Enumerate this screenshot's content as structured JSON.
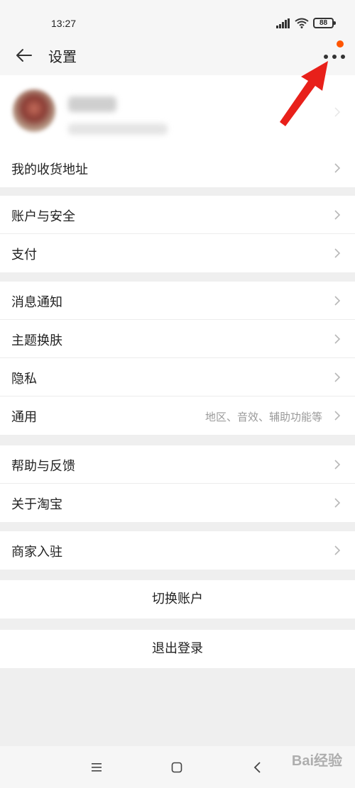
{
  "status_bar": {
    "time": "13:27",
    "battery": "88"
  },
  "header": {
    "title": "设置"
  },
  "groups": [
    {
      "items": [
        {
          "label": "我的收货地址"
        }
      ]
    },
    {
      "items": [
        {
          "label": "账户与安全"
        },
        {
          "label": "支付"
        }
      ]
    },
    {
      "items": [
        {
          "label": "消息通知"
        },
        {
          "label": "主题换肤"
        },
        {
          "label": "隐私"
        },
        {
          "label": "通用",
          "hint": "地区、音效、辅助功能等"
        }
      ]
    },
    {
      "items": [
        {
          "label": "帮助与反馈"
        },
        {
          "label": "关于淘宝"
        }
      ]
    },
    {
      "items": [
        {
          "label": "商家入驻"
        }
      ]
    }
  ],
  "actions": {
    "switch_account": "切换账户",
    "logout": "退出登录"
  },
  "watermark": "Bai经验",
  "colors": {
    "accent": "#ff5500",
    "arrow": "#e8201a",
    "background": "#efefef"
  }
}
